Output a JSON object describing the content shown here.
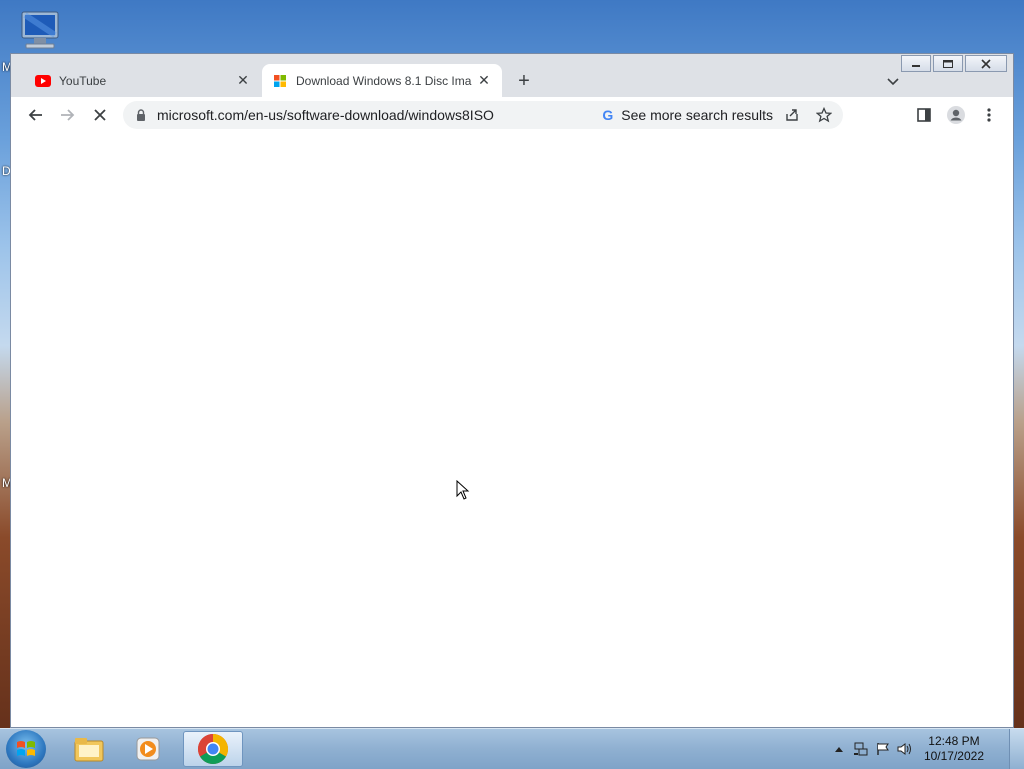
{
  "desktop": {
    "edge_letters": [
      "M",
      "D",
      "M"
    ]
  },
  "window": {
    "tabs": [
      {
        "title": "YouTube",
        "favicon": "youtube-icon",
        "active": false
      },
      {
        "title": "Download Windows 8.1 Disc Ima",
        "favicon": "microsoft-icon",
        "active": true
      }
    ]
  },
  "toolbar": {
    "url": "microsoft.com/en-us/software-download/windows8ISO",
    "search_chip": "See more search results"
  },
  "taskbar": {
    "time": "12:48 PM",
    "date": "10/17/2022"
  },
  "colors": {
    "tabstrip_bg": "#dee1e6",
    "youtube_red": "#ff0000",
    "taskbar": "#8fb0d1"
  }
}
